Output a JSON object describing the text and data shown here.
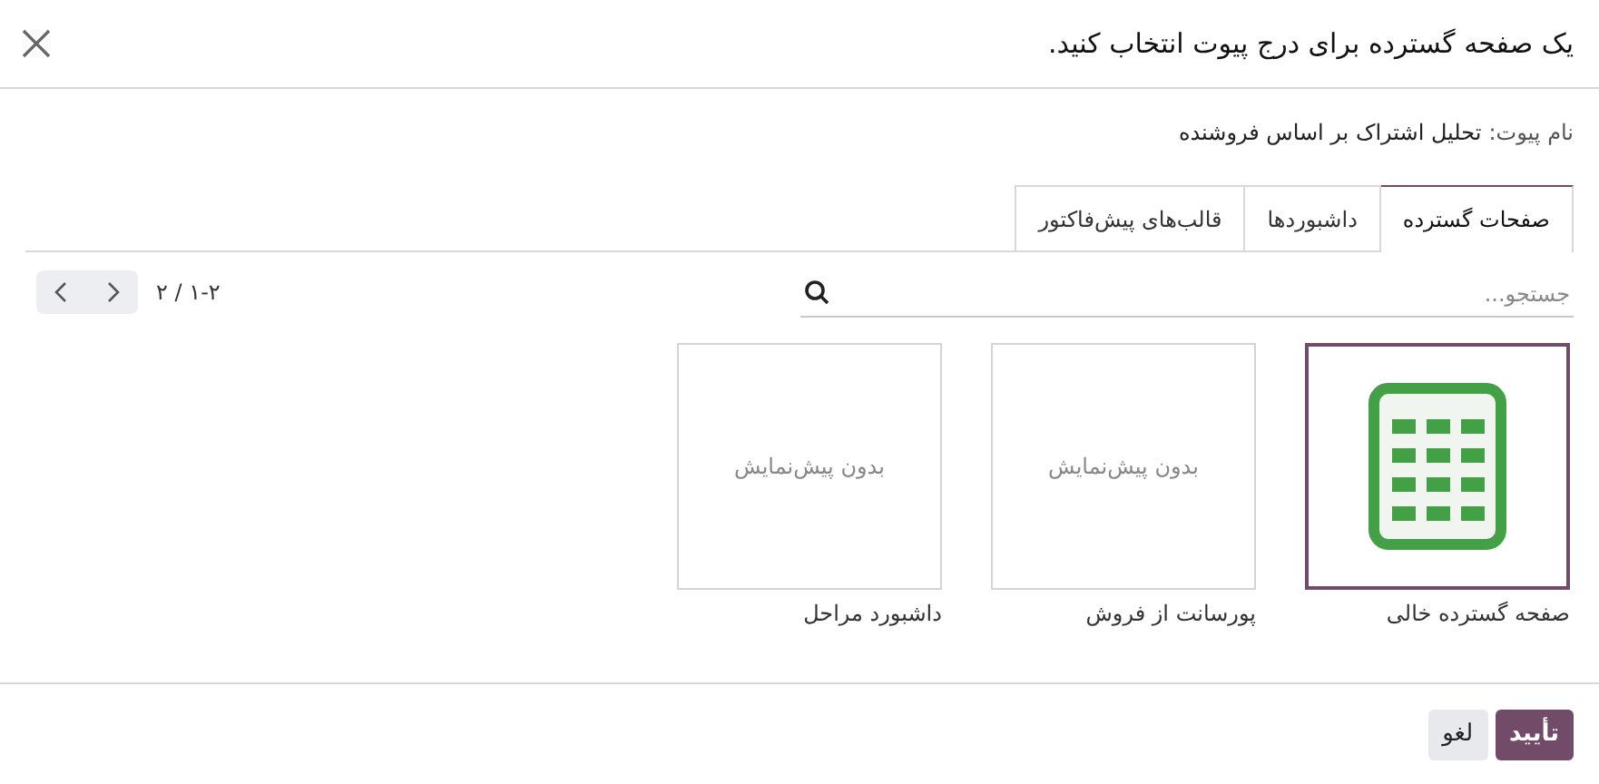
{
  "dialog": {
    "title": "یک صفحه گسترده برای درج پیوت انتخاب کنید."
  },
  "pivot_name": {
    "label": "نام پیوت:",
    "value": "تحلیل اشتراک بر اساس فروشنده"
  },
  "tabs": [
    {
      "label": "صفحات گسترده",
      "selected": true
    },
    {
      "label": "داشبوردها",
      "selected": false
    },
    {
      "label": "قالب‌های پیش‌فاکتور",
      "selected": false
    }
  ],
  "search": {
    "placeholder": "جستجو..."
  },
  "pager": {
    "text": "۱-۲ / ۲"
  },
  "items": [
    {
      "kind": "spreadsheet",
      "caption": "صفحه گسترده خالی",
      "selected": true
    },
    {
      "kind": "no-preview",
      "preview_text": "بدون پیش‌نمایش",
      "caption": "پورسانت از فروش",
      "selected": false
    },
    {
      "kind": "no-preview",
      "preview_text": "بدون پیش‌نمایش",
      "caption": "داشبورد مراحل",
      "selected": false
    }
  ],
  "buttons": [
    {
      "label": "تأیید",
      "kind": "primary"
    },
    {
      "label": "لغو",
      "kind": "secondary"
    }
  ]
}
